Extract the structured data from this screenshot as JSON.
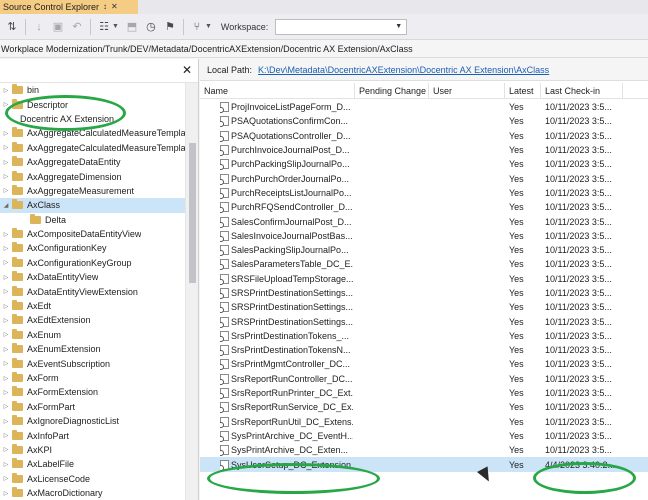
{
  "tool_window": {
    "title": "Source Control Explorer",
    "pin_glyph": "↕",
    "close_glyph": "✕"
  },
  "toolbar": {
    "workspace_label": "Workspace:",
    "workspace_value": ""
  },
  "server_path": "Workplace Modernization/Trunk/DEV/Metadata/DocentricAXExtension/Docentric AX Extension/AxClass",
  "folder_tree": {
    "close_glyph": "✕",
    "items": [
      {
        "label": "bin",
        "expander": "▷",
        "indent": 0,
        "folder": true
      },
      {
        "label": "Descriptor",
        "expander": "▷",
        "indent": 0,
        "folder": true
      },
      {
        "label": "Docentric AX Extension",
        "expander": "",
        "indent": 0,
        "folder": false
      },
      {
        "label": "AxAggregateCalculatedMeasureTempla",
        "expander": "▷",
        "indent": 0,
        "folder": true
      },
      {
        "label": "AxAggregateCalculatedMeasureTempla",
        "expander": "▷",
        "indent": 0,
        "folder": true
      },
      {
        "label": "AxAggregateDataEntity",
        "expander": "▷",
        "indent": 0,
        "folder": true
      },
      {
        "label": "AxAggregateDimension",
        "expander": "▷",
        "indent": 0,
        "folder": true
      },
      {
        "label": "AxAggregateMeasurement",
        "expander": "▷",
        "indent": 0,
        "folder": true
      },
      {
        "label": "AxClass",
        "expander": "◢",
        "indent": 0,
        "folder": true,
        "selected": true
      },
      {
        "label": "Delta",
        "expander": "",
        "indent": 1,
        "folder": true
      },
      {
        "label": "AxCompositeDataEntityView",
        "expander": "▷",
        "indent": 0,
        "folder": true
      },
      {
        "label": "AxConfigurationKey",
        "expander": "▷",
        "indent": 0,
        "folder": true
      },
      {
        "label": "AxConfigurationKeyGroup",
        "expander": "▷",
        "indent": 0,
        "folder": true
      },
      {
        "label": "AxDataEntityView",
        "expander": "▷",
        "indent": 0,
        "folder": true
      },
      {
        "label": "AxDataEntityViewExtension",
        "expander": "▷",
        "indent": 0,
        "folder": true
      },
      {
        "label": "AxEdt",
        "expander": "▷",
        "indent": 0,
        "folder": true
      },
      {
        "label": "AxEdtExtension",
        "expander": "▷",
        "indent": 0,
        "folder": true
      },
      {
        "label": "AxEnum",
        "expander": "▷",
        "indent": 0,
        "folder": true
      },
      {
        "label": "AxEnumExtension",
        "expander": "▷",
        "indent": 0,
        "folder": true
      },
      {
        "label": "AxEventSubscription",
        "expander": "▷",
        "indent": 0,
        "folder": true
      },
      {
        "label": "AxForm",
        "expander": "▷",
        "indent": 0,
        "folder": true
      },
      {
        "label": "AxFormExtension",
        "expander": "▷",
        "indent": 0,
        "folder": true
      },
      {
        "label": "AxFormPart",
        "expander": "▷",
        "indent": 0,
        "folder": true
      },
      {
        "label": "AxIgnoreDiagnosticList",
        "expander": "▷",
        "indent": 0,
        "folder": true
      },
      {
        "label": "AxInfoPart",
        "expander": "▷",
        "indent": 0,
        "folder": true
      },
      {
        "label": "AxKPI",
        "expander": "▷",
        "indent": 0,
        "folder": true
      },
      {
        "label": "AxLabelFile",
        "expander": "▷",
        "indent": 0,
        "folder": true
      },
      {
        "label": "AxLicenseCode",
        "expander": "▷",
        "indent": 0,
        "folder": true
      },
      {
        "label": "AxMacroDictionary",
        "expander": "▷",
        "indent": 0,
        "folder": true
      }
    ]
  },
  "details": {
    "local_path_label": "Local Path:",
    "local_path_value": "K:\\Dev\\Metadata\\DocentricAXExtension\\Docentric AX Extension\\AxClass",
    "columns": [
      "Name",
      "Pending Change",
      "User",
      "Latest",
      "Last Check-in"
    ],
    "rows": [
      {
        "name": "ProjInvoiceListPageForm_D...",
        "pending": "",
        "user": "",
        "latest": "Yes",
        "checkin": "10/11/2023 3:5..."
      },
      {
        "name": "PSAQuotationsConfirmCon...",
        "pending": "",
        "user": "",
        "latest": "Yes",
        "checkin": "10/11/2023 3:5..."
      },
      {
        "name": "PSAQuotationsController_D...",
        "pending": "",
        "user": "",
        "latest": "Yes",
        "checkin": "10/11/2023 3:5..."
      },
      {
        "name": "PurchInvoiceJournalPost_D...",
        "pending": "",
        "user": "",
        "latest": "Yes",
        "checkin": "10/11/2023 3:5..."
      },
      {
        "name": "PurchPackingSlipJournalPo...",
        "pending": "",
        "user": "",
        "latest": "Yes",
        "checkin": "10/11/2023 3:5..."
      },
      {
        "name": "PurchPurchOrderJournalPo...",
        "pending": "",
        "user": "",
        "latest": "Yes",
        "checkin": "10/11/2023 3:5..."
      },
      {
        "name": "PurchReceiptsListJournalPo...",
        "pending": "",
        "user": "",
        "latest": "Yes",
        "checkin": "10/11/2023 3:5..."
      },
      {
        "name": "PurchRFQSendController_D...",
        "pending": "",
        "user": "",
        "latest": "Yes",
        "checkin": "10/11/2023 3:5..."
      },
      {
        "name": "SalesConfirmJournalPost_D...",
        "pending": "",
        "user": "",
        "latest": "Yes",
        "checkin": "10/11/2023 3:5..."
      },
      {
        "name": "SalesInvoiceJournalPostBas...",
        "pending": "",
        "user": "",
        "latest": "Yes",
        "checkin": "10/11/2023 3:5..."
      },
      {
        "name": "SalesPackingSlipJournalPo...",
        "pending": "",
        "user": "",
        "latest": "Yes",
        "checkin": "10/11/2023 3:5..."
      },
      {
        "name": "SalesParametersTable_DC_E...",
        "pending": "",
        "user": "",
        "latest": "Yes",
        "checkin": "10/11/2023 3:5..."
      },
      {
        "name": "SRSFileUploadTempStorage...",
        "pending": "",
        "user": "",
        "latest": "Yes",
        "checkin": "10/11/2023 3:5..."
      },
      {
        "name": "SRSPrintDestinationSettings...",
        "pending": "",
        "user": "",
        "latest": "Yes",
        "checkin": "10/11/2023 3:5..."
      },
      {
        "name": "SRSPrintDestinationSettings...",
        "pending": "",
        "user": "",
        "latest": "Yes",
        "checkin": "10/11/2023 3:5..."
      },
      {
        "name": "SRSPrintDestinationSettings...",
        "pending": "",
        "user": "",
        "latest": "Yes",
        "checkin": "10/11/2023 3:5..."
      },
      {
        "name": "SrsPrintDestinationTokens_...",
        "pending": "",
        "user": "",
        "latest": "Yes",
        "checkin": "10/11/2023 3:5..."
      },
      {
        "name": "SrsPrintDestinationTokensN...",
        "pending": "",
        "user": "",
        "latest": "Yes",
        "checkin": "10/11/2023 3:5..."
      },
      {
        "name": "SrsPrintMgmtController_DC...",
        "pending": "",
        "user": "",
        "latest": "Yes",
        "checkin": "10/11/2023 3:5..."
      },
      {
        "name": "SrsReportRunController_DC...",
        "pending": "",
        "user": "",
        "latest": "Yes",
        "checkin": "10/11/2023 3:5..."
      },
      {
        "name": "SrsReportRunPrinter_DC_Ext...",
        "pending": "",
        "user": "",
        "latest": "Yes",
        "checkin": "10/11/2023 3:5..."
      },
      {
        "name": "SrsReportRunService_DC_Ex...",
        "pending": "",
        "user": "",
        "latest": "Yes",
        "checkin": "10/11/2023 3:5..."
      },
      {
        "name": "SrsReportRunUtil_DC_Extens...",
        "pending": "",
        "user": "",
        "latest": "Yes",
        "checkin": "10/11/2023 3:5..."
      },
      {
        "name": "SysPrintArchive_DC_EventH...",
        "pending": "",
        "user": "",
        "latest": "Yes",
        "checkin": "10/11/2023 3:5..."
      },
      {
        "name": "SysPrintArchive_DC_Exten...",
        "pending": "",
        "user": "",
        "latest": "Yes",
        "checkin": "10/11/2023 3:5..."
      },
      {
        "name": "SysUserSetup_DC_Extension...",
        "pending": "",
        "user": "",
        "latest": "Yes",
        "checkin": "4/4/2023 3:40:2...",
        "selected": true
      }
    ]
  },
  "colors": {
    "accent_tab": "#f5cc84",
    "selection": "#cce4f7",
    "highlight_oval": "#27a745",
    "link": "#1a5fb4"
  }
}
